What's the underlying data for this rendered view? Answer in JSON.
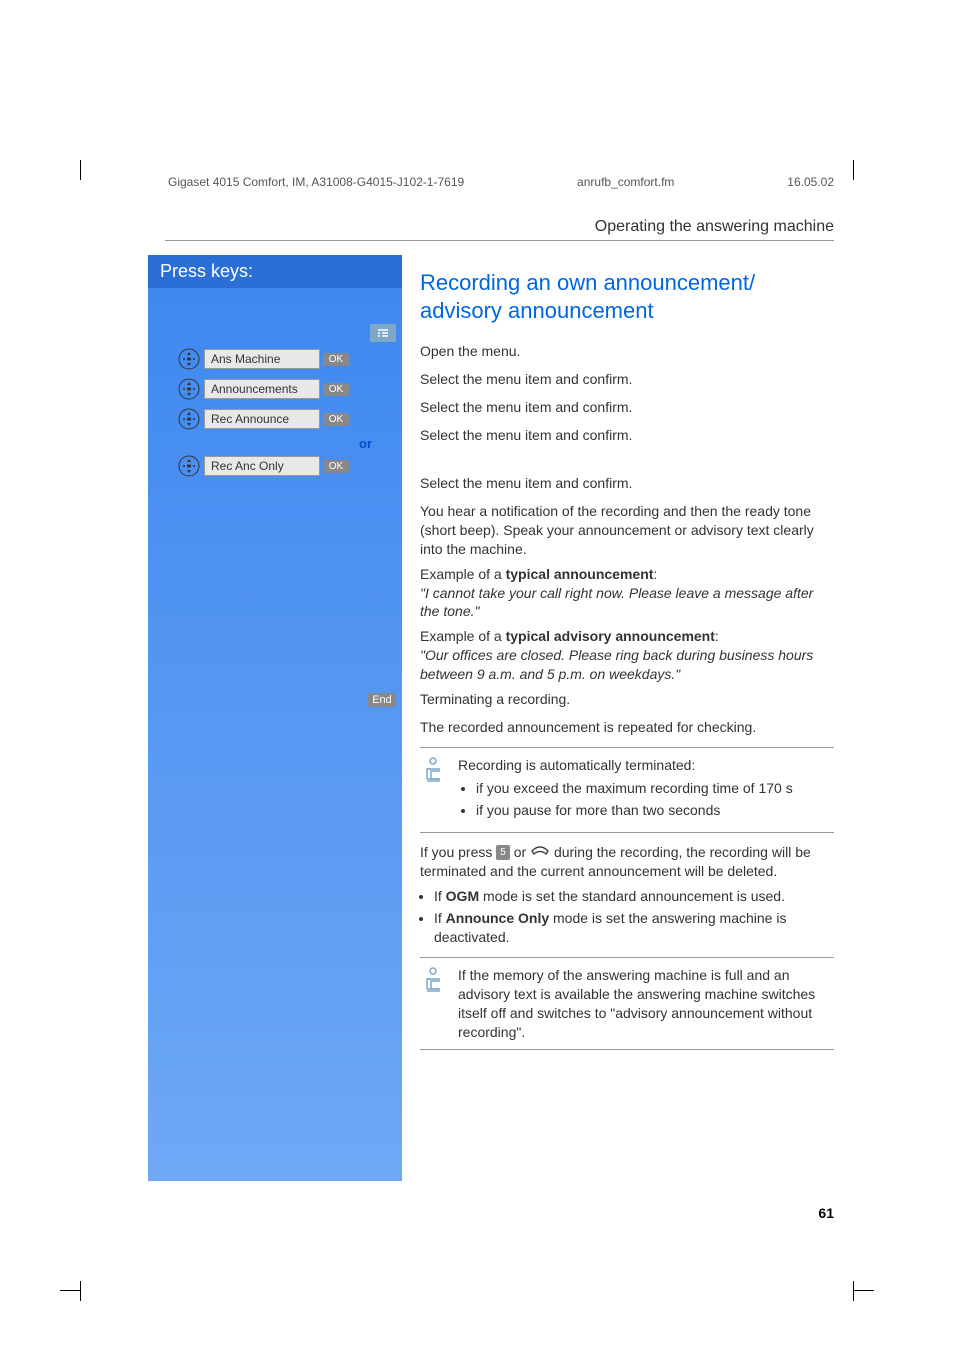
{
  "header": {
    "doc_ref": "Gigaset 4015 Comfort, IM, A31008-G4015-J102-1-7619",
    "filename": "anrufb_comfort.fm",
    "date": "16.05.02"
  },
  "section_title": "Operating the answering machine",
  "sidebar": {
    "title": "Press keys:",
    "or_label": "or"
  },
  "menu_items": {
    "ans_machine": "Ans Machine",
    "announcements": "Announcements",
    "rec_announce": "Rec Announce",
    "rec_anc_only": "Rec Anc Only"
  },
  "buttons": {
    "ok": "OK",
    "end": "End",
    "five": "5"
  },
  "heading": "Recording an own announcement/ advisory announcement",
  "steps": {
    "open_menu": "Open the menu.",
    "select_confirm": "Select the menu item and confirm.",
    "terminate": "Terminating a recording.",
    "repeated": "The recorded announcement is repeated for checking."
  },
  "body": {
    "notification": "You hear a notification of the recording and then the ready tone (short beep). Speak your announcement or advisory text clearly into the machine.",
    "example_typical_label": "Example of a ",
    "typical_announcement_bold": "typical announcement",
    "example_typical_text": "\"I cannot take your call right now. Please leave a message after the tone.\"",
    "example_advisory_label": "Example of a ",
    "typical_advisory_bold": "typical advisory announcement",
    "example_advisory_text": "\"Our offices are closed. Please ring back during business hours between 9 a.m. and 5 p.m. on weekdays.\""
  },
  "info1": {
    "line1": "Recording is automatically terminated:",
    "bullet1": "if you exceed the maximum recording time of 170 s",
    "bullet2": "if you pause for more than two seconds"
  },
  "press_note": {
    "pre": "If you press ",
    "post": " during the recording, the recording will be terminated and the current announcement will be deleted.",
    "or_word": " or "
  },
  "modes": {
    "ogm_pre": "If ",
    "ogm_bold": "OGM",
    "ogm_post": " mode is set the standard announcement is used.",
    "anc_pre": "If ",
    "anc_bold": "Announce Only",
    "anc_post": " mode is set the answering machine is deactivated."
  },
  "info2": {
    "text": "If the memory of the answering machine is full and an advisory text is available the answering machine switches itself off and switches to \"advisory announcement without recording\"."
  },
  "page_number": "61"
}
